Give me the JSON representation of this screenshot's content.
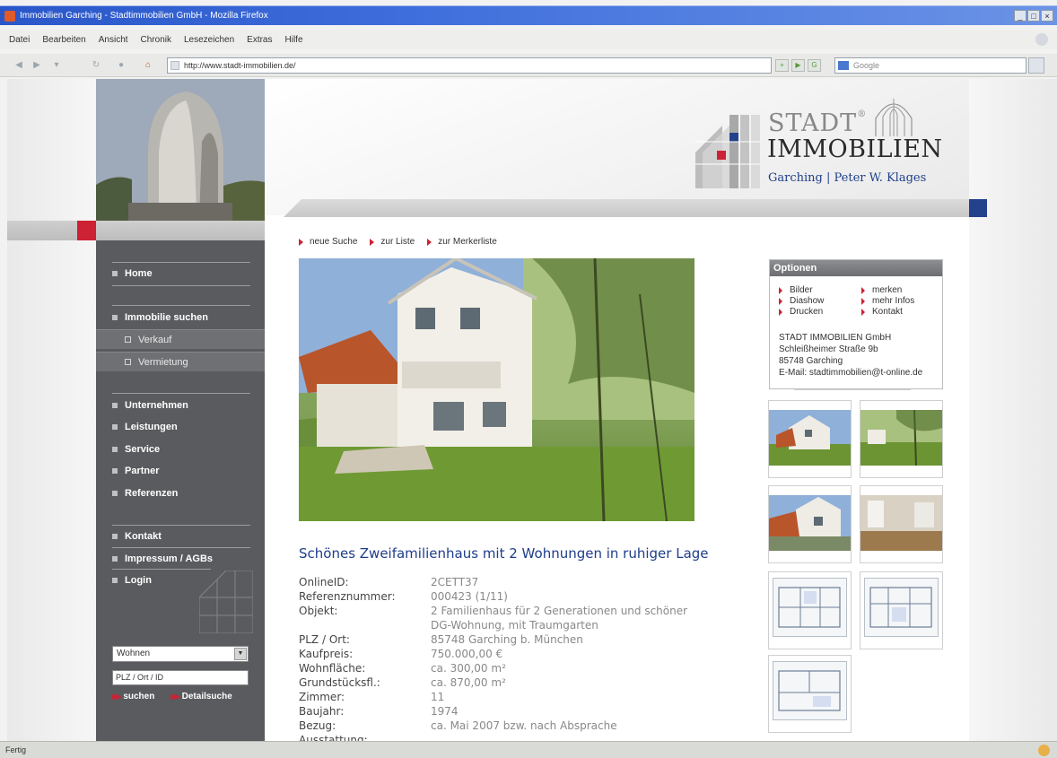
{
  "browser": {
    "title": "Immobilien Garching - Stadtimmobilien GmbH - Mozilla Firefox",
    "window_buttons": [
      "_",
      "□",
      "×"
    ],
    "menu": [
      "Datei",
      "Bearbeiten",
      "Ansicht",
      "Chronik",
      "Lesezeichen",
      "Extras",
      "Hilfe"
    ],
    "url": "http://www.stadt-immobilien.de/",
    "search_placeholder": "Google",
    "status": "Fertig"
  },
  "logo": {
    "line1": "STADT",
    "reg": "®",
    "line2": "IMMOBILIEN",
    "tagline": "Garching | Peter W. Klages"
  },
  "breadcrumbs": [
    "neue Suche",
    "zur Liste",
    "zur Merkerliste"
  ],
  "nav": {
    "home": "Home",
    "immobilie_suchen": "Immobilie suchen",
    "verkauf": "Verkauf",
    "vermietung": "Vermietung",
    "unternehmen": "Unternehmen",
    "leistungen": "Leistungen",
    "service": "Service",
    "partner": "Partner",
    "referenzen": "Referenzen",
    "kontakt": "Kontakt",
    "impressum": "Impressum / AGBs",
    "login": "Login"
  },
  "quicksearch": {
    "select_value": "Wohnen",
    "input_value": "PLZ / Ort / ID",
    "suchen": "suchen",
    "detailsuche": "Detailsuche"
  },
  "listing": {
    "title": "Schönes Zweifamilienhaus mit 2 Wohnungen in ruhiger Lage",
    "details": [
      {
        "label": "OnlineID:",
        "value": "2CETT37"
      },
      {
        "label": "Referenznummer:",
        "value": "000423 (1/11)"
      },
      {
        "label": "Objekt:",
        "value": "2 Familienhaus für 2 Generationen und schöner"
      },
      {
        "label": "",
        "value": "DG-Wohnung, mit Traumgarten"
      },
      {
        "label": "PLZ / Ort:",
        "value": "85748 Garching b. München"
      },
      {
        "label": "Kaufpreis:",
        "value": "750.000,00 €"
      },
      {
        "label": "Wohnfläche:",
        "value": "ca. 300,00 m²"
      },
      {
        "label": "Grundstücksfl.:",
        "value": "ca. 870,00 m²"
      },
      {
        "label": "Zimmer:",
        "value": "11"
      },
      {
        "label": "Baujahr:",
        "value": "1974"
      },
      {
        "label": "Bezug:",
        "value": "ca. Mai 2007 bzw. nach Absprache"
      },
      {
        "label": "Ausstattung:",
        "value": ""
      }
    ]
  },
  "options": {
    "header": "Optionen",
    "links": [
      "Bilder",
      "merken",
      "Diashow",
      "mehr Infos",
      "Drucken",
      "Kontakt"
    ],
    "company": [
      "STADT IMMOBILIEN GmbH",
      "Schleißheimer Straße 9b",
      "85748 Garching",
      "E-Mail: stadtimmobilien@t-online.de"
    ]
  },
  "colors": {
    "accent_red": "#cc2233",
    "accent_blue": "#24418c",
    "sidebar": "#595b5e",
    "title_blue": "#1e3d8a"
  }
}
